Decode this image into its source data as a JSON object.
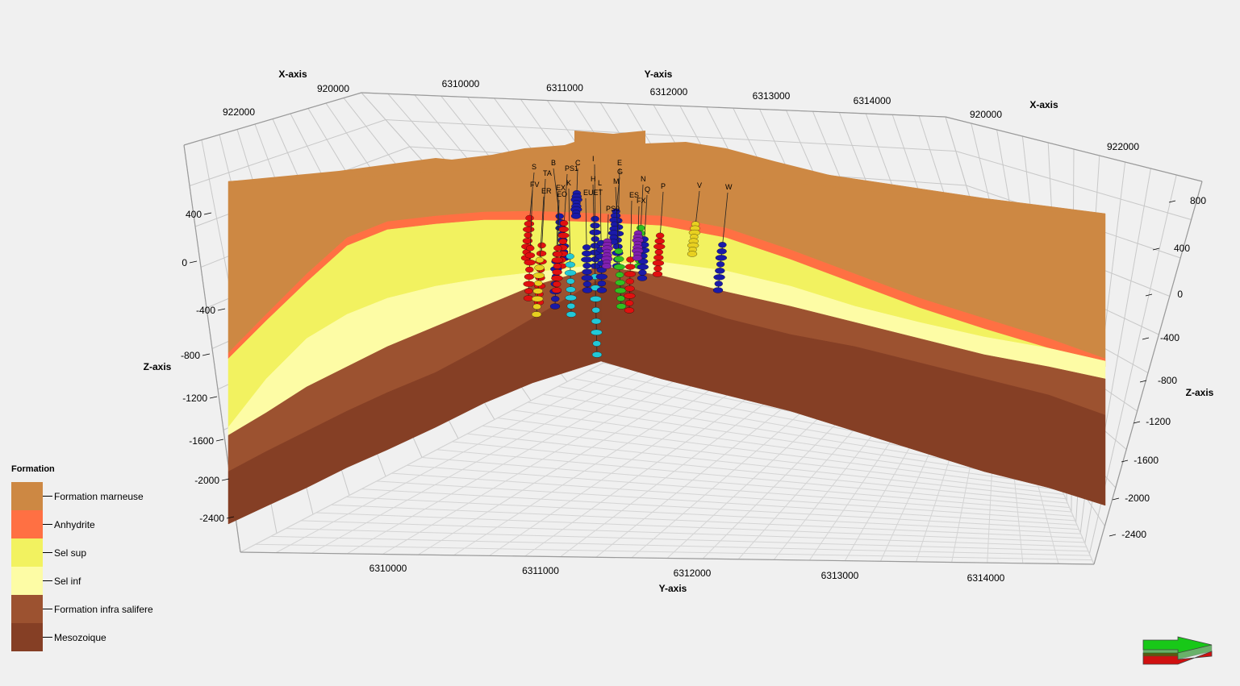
{
  "axes": {
    "x_title_left": "X-axis",
    "x_title_right": "X-axis",
    "y_title_top": "Y-axis",
    "y_title_bottom": "Y-axis",
    "z_title_left": "Z-axis",
    "z_title_right": "Z-axis",
    "x_ticks_left": [
      "920000",
      "922000"
    ],
    "x_ticks_right": [
      "920000",
      "922000"
    ],
    "y_ticks_top": [
      "6310000",
      "6311000",
      "6312000",
      "6313000",
      "6314000"
    ],
    "y_ticks_bottom": [
      "6310000",
      "6311000",
      "6312000",
      "6313000",
      "6314000"
    ],
    "z_ticks_left": [
      "400",
      "0",
      "-400",
      "-800",
      "-1200",
      "-1600",
      "-2000",
      "-2400"
    ],
    "z_ticks_right": [
      "800",
      "400",
      "0",
      "-400",
      "-800",
      "-1200",
      "-1600",
      "-2000",
      "-2400"
    ]
  },
  "legend": {
    "title": "Formation",
    "items": [
      {
        "label": "Formation marneuse",
        "color": "#cd8843"
      },
      {
        "label": "Anhydrite",
        "color": "#ff7043"
      },
      {
        "label": "Sel sup",
        "color": "#f2f260"
      },
      {
        "label": "Sel inf",
        "color": "#fdfca5"
      },
      {
        "label": "Formation infra salifere",
        "color": "#9c5230"
      },
      {
        "label": "Mesozoique",
        "color": "#853f25"
      }
    ]
  },
  "wells": [
    "S",
    "B",
    "C",
    "I",
    "E",
    "TA",
    "PS1",
    "G",
    "H",
    "L",
    "N",
    "FV",
    "ER",
    "EX",
    "K",
    "EUET",
    "M",
    "ES",
    "Q",
    "P",
    "V",
    "W",
    "EO",
    "PS0",
    "FX"
  ],
  "well_colors": [
    "#e01010",
    "#1a1aa8",
    "#e8d020",
    "#22c8d8",
    "#30c020",
    "#8020b0"
  ],
  "nav_arrow_colors": {
    "top": "#18c818",
    "bottom": "#d01010"
  }
}
